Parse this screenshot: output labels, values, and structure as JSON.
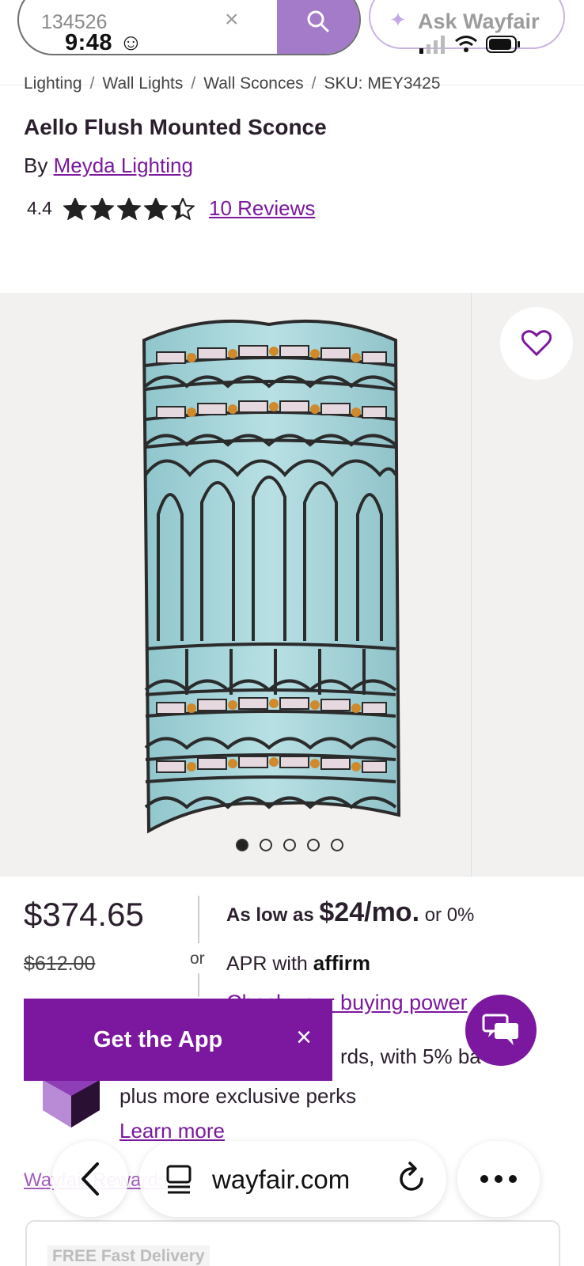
{
  "status": {
    "time": "9:48"
  },
  "search": {
    "query": "134526"
  },
  "ask": {
    "label": "Ask Wayfair"
  },
  "breadcrumb": [
    "Lighting",
    "Wall Lights",
    "Wall Sconces",
    "SKU: MEY3425"
  ],
  "product": {
    "title": "Aello Flush Mounted Sconce",
    "by_prefix": "By",
    "brand": "Meyda Lighting",
    "rating": "4.4",
    "rating_value": 4.4,
    "reviews": "10 Reviews"
  },
  "gallery": {
    "image_count": 5,
    "active_index": 0
  },
  "pricing": {
    "price": "$374.65",
    "was_price": "$612.00",
    "or": "or",
    "as_low_prefix": "As low as",
    "monthly": "$24/mo.",
    "as_low_suffix": "or 0%",
    "apr_prefix": "APR with",
    "affirm": "affirm",
    "buying_power": "Check your buying power"
  },
  "app_banner": {
    "label": "Get the App",
    "close": "×"
  },
  "perks": {
    "line1": "rds, with 5% ba",
    "line2": "plus more exclusive perks",
    "learn_more": "Learn more"
  },
  "partial_link": "Wayfair Rewards",
  "browser": {
    "url": "wayfair.com"
  },
  "delivery": {
    "badge": "FREE Fast Delivery"
  },
  "colors": {
    "brand": "#7b189f",
    "search_button": "#a47bc8"
  }
}
